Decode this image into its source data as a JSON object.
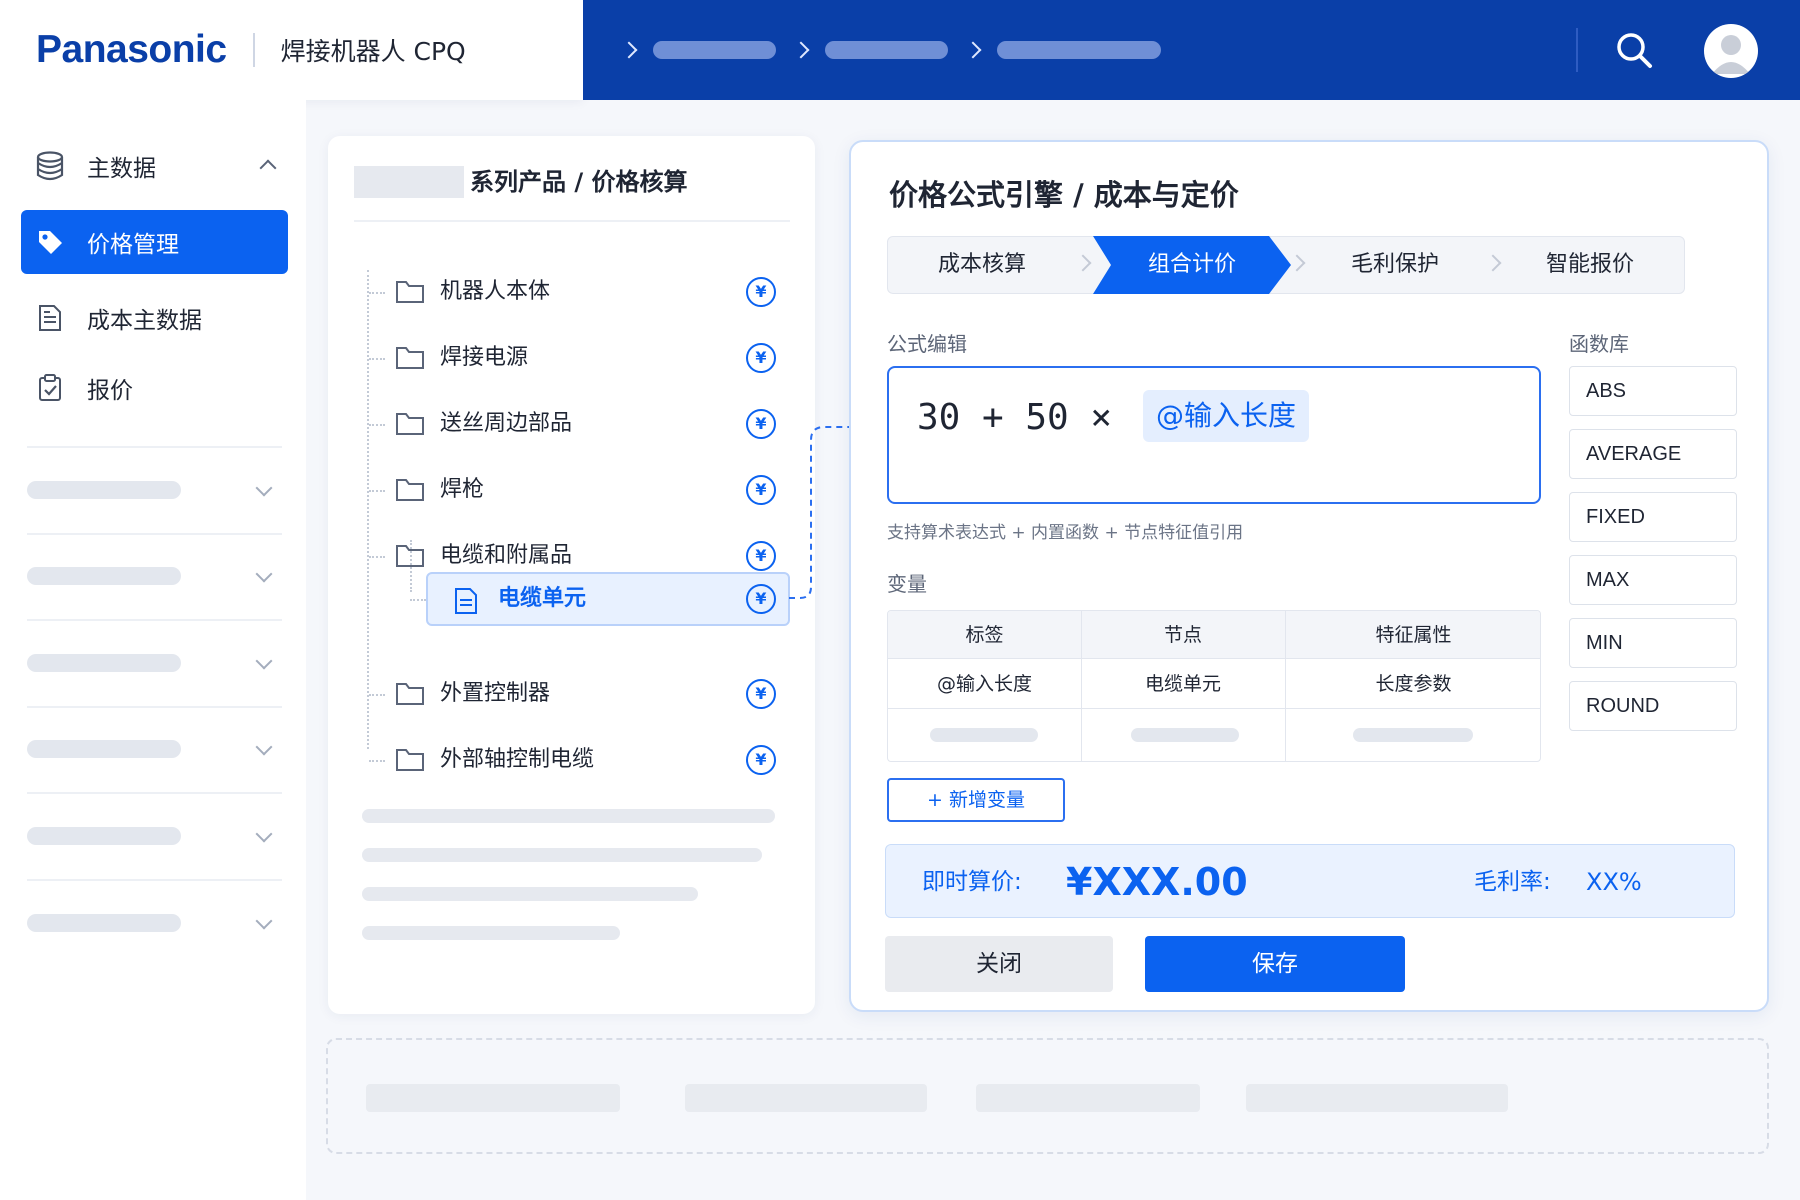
{
  "header": {
    "logo": "Panasonic",
    "app_title": "焊接机器人 CPQ",
    "breadcrumb_count": 3,
    "search_icon": "search-icon",
    "avatar_icon": "user-avatar-icon"
  },
  "sidebar": {
    "items": [
      {
        "label": "主数据",
        "icon": "database-icon"
      },
      {
        "label": "价格管理",
        "icon": "price-tag-icon",
        "active": true
      },
      {
        "label": "成本主数据",
        "icon": "document-icon"
      },
      {
        "label": "报价",
        "icon": "clipboard-check-icon"
      }
    ]
  },
  "tree": {
    "title": "系列产品 / 价格核算",
    "nodes": [
      {
        "label": "机器人本体",
        "icon": "folder-icon"
      },
      {
        "label": "焊接电源",
        "icon": "folder-icon"
      },
      {
        "label": "送丝周边部品",
        "icon": "folder-icon"
      },
      {
        "label": "焊枪",
        "icon": "folder-icon"
      },
      {
        "label": "电缆和附属品",
        "icon": "folder-icon"
      },
      {
        "label": "电缆单元",
        "icon": "document-icon",
        "selected": true
      },
      {
        "label": "外置控制器",
        "icon": "folder-icon"
      },
      {
        "label": "外部轴控制电缆",
        "icon": "folder-icon"
      }
    ],
    "price_badge": "¥"
  },
  "editor": {
    "title": "价格公式引擎 / 成本与定价",
    "steps": [
      "成本核算",
      "组合计价",
      "毛利保护",
      "智能报价"
    ],
    "active_step": "组合计价",
    "formula_label": "公式编辑",
    "formula_expr": "30 + 50 ×",
    "formula_token": "@输入长度",
    "hint": "支持算术表达式 + 内置函数 + 节点特征值引用",
    "variables_label": "变量",
    "variables_table": {
      "headers": [
        "标签",
        "节点",
        "特征属性"
      ],
      "rows": [
        [
          "@输入长度",
          "电缆单元",
          "长度参数"
        ]
      ]
    },
    "add_variable": "+ 新增变量",
    "function_library_label": "函数库",
    "functions": [
      "ABS",
      "AVERAGE",
      "FIXED",
      "MAX",
      "MIN",
      "ROUND"
    ],
    "price_label": "即时算价:",
    "price_value": "¥XXX.00",
    "margin_label": "毛利率:",
    "margin_value": "XX%",
    "close_button": "关闭",
    "save_button": "保存"
  },
  "colors": {
    "brand_blue": "#0a3fa8",
    "accent_blue": "#0b62f0",
    "tint_blue": "#eaf2ff"
  }
}
